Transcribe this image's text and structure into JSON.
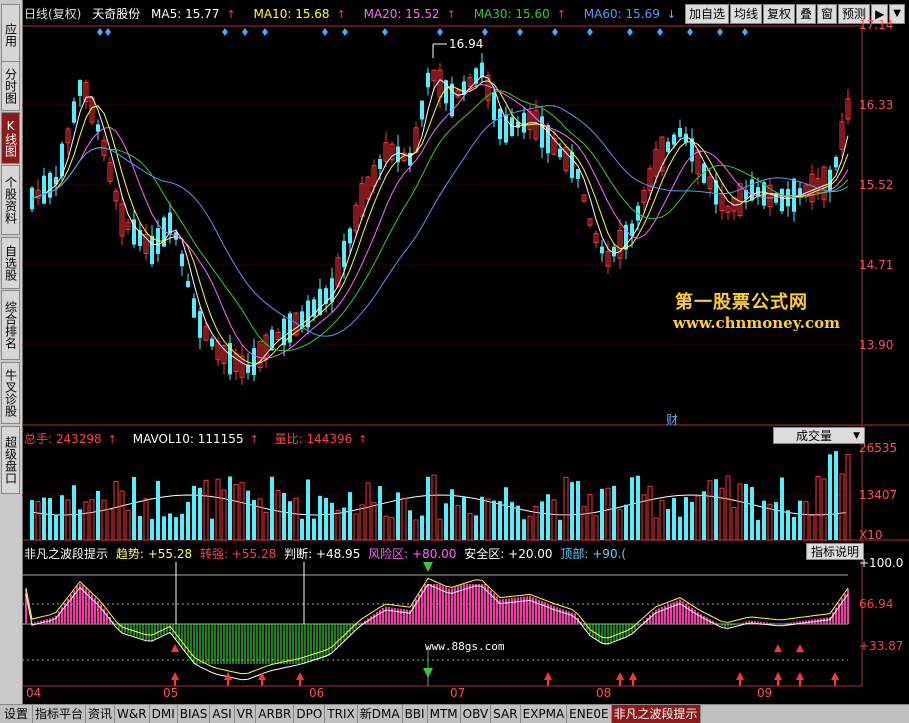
{
  "sidebar": {
    "tabs": [
      "应用",
      "分时图",
      "K线图",
      "个股资料",
      "自选股",
      "综合排名",
      "牛叉诊股",
      "超级盘口"
    ],
    "active_index": 2
  },
  "header": {
    "period": "日线(复权)",
    "stock_name": "天奇股份",
    "ma5_label": "MA5: 15.77",
    "ma10_label": "MA10: 15.68",
    "ma20_label": "MA20: 15.52",
    "ma30_label": "MA30: 15.60",
    "ma60_label": "MA60: 15.69",
    "colors": {
      "ma5": "#ffffff",
      "ma10": "#ffff00",
      "ma20": "#ff66ff",
      "ma30": "#33cc33",
      "ma60": "#5599ff"
    }
  },
  "toolbar": {
    "buttons": [
      "加自选",
      "均线",
      "复权",
      "叠",
      "窗",
      "预测"
    ],
    "arrow_icon": "▶",
    "down_icon": "▼"
  },
  "price_axis": [
    "17.14",
    "16.33",
    "15.52",
    "14.71",
    "13.90"
  ],
  "annotations": {
    "high_label": "16.94",
    "finance_marker": "财"
  },
  "watermark": {
    "line1": "第一股票公式网",
    "line2": "www.chnmoney.com",
    "small": "www.88gs.com"
  },
  "volume": {
    "total_label": "总手: 243298",
    "mavol_label": "MAVOL10: 111155",
    "ratio_label": "量比: 144396",
    "select_value": "成交量",
    "axis": [
      "26535",
      "13407",
      "X10"
    ]
  },
  "oscillator": {
    "name": "非凡之波段提示",
    "trend_label": "趋势: +55.28",
    "turn_label": "转强: +55.28",
    "judge_label": "判断: +48.95",
    "risk_label": "风险区: +80.00",
    "safe_label": "安全区: +20.00",
    "top_label": "顶部: +90.(",
    "explain_button": "指标说明",
    "axis": [
      "+100.0",
      "66.94",
      "+33.87"
    ]
  },
  "date_axis": [
    "04",
    "05",
    "06",
    "07",
    "08",
    "09"
  ],
  "bottom_tabs": [
    "设置",
    "指标平台",
    "资讯",
    "W&R",
    "DMI",
    "BIAS",
    "ASI",
    "VR",
    "ARBR",
    "DPO",
    "TRIX",
    "新DMA",
    "BBI",
    "MTM",
    "OBV",
    "SAR",
    "EXPMA",
    "ENE0E",
    "非凡之波段提示"
  ],
  "bottom_active_index": 18
}
